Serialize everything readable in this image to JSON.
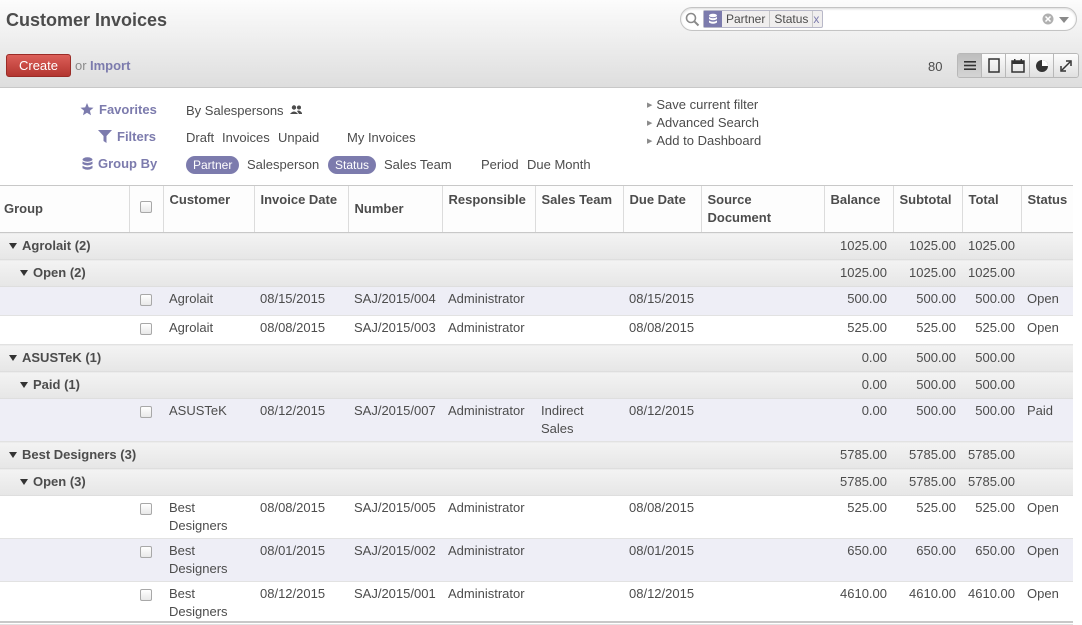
{
  "header": {
    "title": "Customer Invoices",
    "create_label": "Create",
    "or_label": "or",
    "import_label": "Import",
    "pager": "80"
  },
  "search": {
    "facet_values": [
      "Partner",
      "Status"
    ],
    "facet_remove": "x",
    "placeholder": ""
  },
  "views": [
    {
      "name": "list-view",
      "icon": "list-icon",
      "active": true
    },
    {
      "name": "form-view",
      "icon": "form-icon",
      "active": false
    },
    {
      "name": "calendar-view",
      "icon": "calendar-icon",
      "active": false
    },
    {
      "name": "graph-view",
      "icon": "pie-chart-icon",
      "active": false
    },
    {
      "name": "fullscreen",
      "icon": "expand-icon",
      "active": false
    }
  ],
  "drawer": {
    "favorites_label": "Favorites",
    "filters_label": "Filters",
    "groupby_label": "Group By",
    "favorites": [
      "By Salespersons"
    ],
    "filters": [
      "Draft",
      "Invoices",
      "Unpaid",
      "My Invoices"
    ],
    "groupby": [
      "Partner",
      "Salesperson",
      "Status",
      "Sales Team",
      "Period",
      "Due Month"
    ],
    "side_links": [
      "Save current filter",
      "Advanced Search",
      "Add to Dashboard"
    ]
  },
  "table": {
    "columns": [
      "Group",
      "",
      "Customer",
      "Invoice Date",
      "Number",
      "Responsible",
      "Sales Team",
      "Due Date",
      "Source Document",
      "Balance",
      "Subtotal",
      "Total",
      "Status"
    ],
    "groups": [
      {
        "label": "Agrolait (2)",
        "balance": "1025.00",
        "subtotal": "1025.00",
        "total": "1025.00",
        "sub": [
          {
            "label": "Open (2)",
            "balance": "1025.00",
            "subtotal": "1025.00",
            "total": "1025.00",
            "rows": [
              {
                "customer": "Agrolait",
                "date": "08/15/2015",
                "number": "SAJ/2015/004",
                "responsible": "Administrator",
                "team": "",
                "due": "08/15/2015",
                "source": "",
                "balance": "500.00",
                "subtotal": "500.00",
                "total": "500.00",
                "status": "Open"
              },
              {
                "customer": "Agrolait",
                "date": "08/08/2015",
                "number": "SAJ/2015/003",
                "responsible": "Administrator",
                "team": "",
                "due": "08/08/2015",
                "source": "",
                "balance": "525.00",
                "subtotal": "525.00",
                "total": "525.00",
                "status": "Open"
              }
            ]
          }
        ]
      },
      {
        "label": "ASUSTeK (1)",
        "balance": "0.00",
        "subtotal": "500.00",
        "total": "500.00",
        "sub": [
          {
            "label": "Paid (1)",
            "balance": "0.00",
            "subtotal": "500.00",
            "total": "500.00",
            "rows": [
              {
                "customer": "ASUSTeK",
                "date": "08/12/2015",
                "number": "SAJ/2015/007",
                "responsible": "Administrator",
                "team": "Indirect Sales",
                "due": "08/12/2015",
                "source": "",
                "balance": "0.00",
                "subtotal": "500.00",
                "total": "500.00",
                "status": "Paid"
              }
            ]
          }
        ]
      },
      {
        "label": "Best Designers (3)",
        "balance": "5785.00",
        "subtotal": "5785.00",
        "total": "5785.00",
        "sub": [
          {
            "label": "Open (3)",
            "balance": "5785.00",
            "subtotal": "5785.00",
            "total": "5785.00",
            "rows": [
              {
                "customer": "Best Designers",
                "date": "08/08/2015",
                "number": "SAJ/2015/005",
                "responsible": "Administrator",
                "team": "",
                "due": "08/08/2015",
                "source": "",
                "balance": "525.00",
                "subtotal": "525.00",
                "total": "525.00",
                "status": "Open"
              },
              {
                "customer": "Best Designers",
                "date": "08/01/2015",
                "number": "SAJ/2015/002",
                "responsible": "Administrator",
                "team": "",
                "due": "08/01/2015",
                "source": "",
                "balance": "650.00",
                "subtotal": "650.00",
                "total": "650.00",
                "status": "Open"
              },
              {
                "customer": "Best Designers",
                "date": "08/12/2015",
                "number": "SAJ/2015/001",
                "responsible": "Administrator",
                "team": "",
                "due": "08/12/2015",
                "source": "",
                "balance": "4610.00",
                "subtotal": "4610.00",
                "total": "4610.00",
                "status": "Open"
              }
            ]
          }
        ]
      }
    ]
  },
  "colors": {
    "accent": "#7c7bad",
    "create": "#c0403a"
  }
}
